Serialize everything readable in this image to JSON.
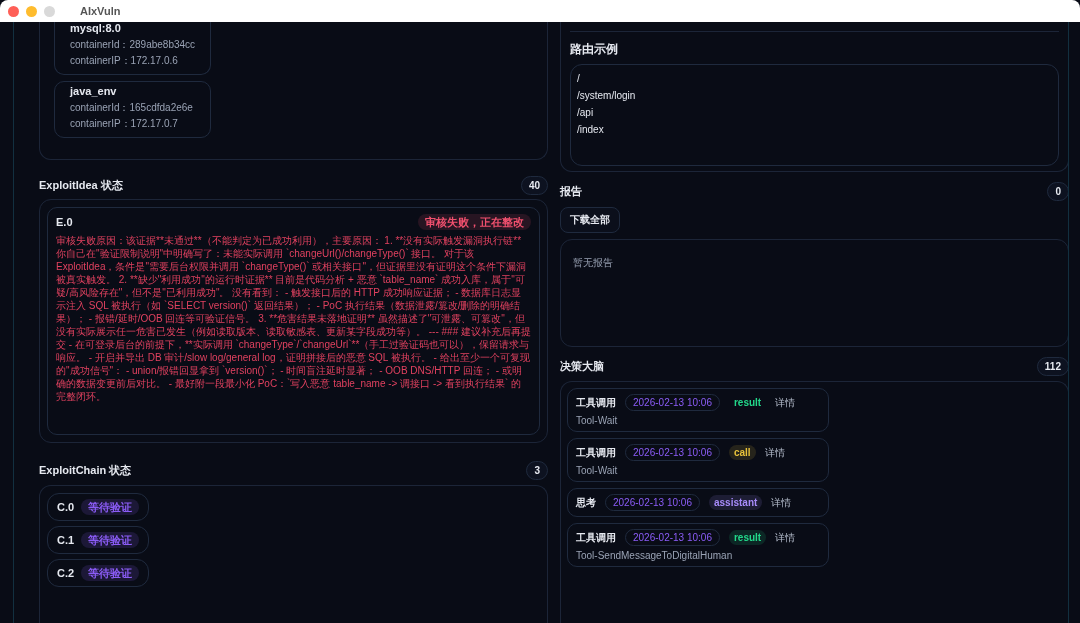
{
  "window": {
    "title": "AIxVuln"
  },
  "containers": [
    {
      "name": "mysql:8.0",
      "id_label": "containerId：",
      "id": "289abe8b34cc",
      "ip_label": "containerIP：",
      "ip": "172.17.0.6"
    },
    {
      "name": "java_env",
      "id_label": "containerId：",
      "id": "165cdfda2e6e",
      "ip_label": "containerIP：",
      "ip": "172.17.0.7"
    }
  ],
  "exploit_idea": {
    "title": "ExploitIdea 状态",
    "count": "40",
    "items": [
      {
        "name": "E.0",
        "status": "审核失败，正在整改",
        "color": "#f0506e",
        "text": "审核失败原因：该证据**未通过**（不能判定为已成功利用），主要原因： 1. **没有实际触发漏洞执行链** 你自己在\"验证限制说明\"中明确写了：未能实际调用 `changeUrl()/changeType()` 接口。 对于该 ExploitIdea，条件是\"需要后台权限并调用 `changeType()` 或相关接口\"，但证据里没有证明这个条件下漏洞被真实触发。 2. **缺少\"利用成功\"的运行时证据** 目前是代码分析 + 恶意 `table_name` 成功入库，属于\"可疑/高风险存在\"，但不是\"已利用成功\"。 没有看到： - 触发接口后的 HTTP 成功响应证据； - 数据库日志显示注入 SQL 被执行（如 `SELECT version()` 返回结果）； - PoC 执行结果（数据泄露/篡改/删除的明确结果）； - 报错/延时/OOB 回连等可验证信号。 3. **危害结果未落地证明** 虽然描述了\"可泄露、可篡改\"，但没有实际展示任一危害已发生（例如读取版本、读取敏感表、更新某字段成功等）。 --- ### 建议补充后再提交 - 在可登录后台的前提下，**实际调用 `changeType`/`changeUrl`**（手工过验证码也可以），保留请求与响应。 - 开启并导出 DB 审计/slow log/general log，证明拼接后的恶意 SQL 被执行。 - 给出至少一个可复现的\"成功信号\"： - union/报错回显拿到 `version()`； - 时间盲注延时显著； - OOB DNS/HTTP 回连； - 或明确的数据变更前后对比。 - 最好附一段最小化 PoC：`写入恶意 table_name -> 调接口 -> 看到执行结果` 的完整闭环。"
      }
    ]
  },
  "exploit_chain": {
    "title": "ExploitChain 状态",
    "count": "3",
    "items": [
      {
        "name": "C.0",
        "status": "等待验证",
        "color": "#8b5cf6"
      },
      {
        "name": "C.1",
        "status": "等待验证",
        "color": "#8b5cf6"
      },
      {
        "name": "C.2",
        "status": "等待验证",
        "color": "#8b5cf6"
      }
    ]
  },
  "routes": {
    "title": "路由示例",
    "items": [
      "/",
      "/system/login",
      "/api",
      "/index"
    ]
  },
  "reports": {
    "title": "报告",
    "count": "0",
    "download_button": "下载全部",
    "empty_text": "暂无报告"
  },
  "brain": {
    "title": "决策大脑",
    "count": "112",
    "entries": [
      {
        "type": "工具调用",
        "time": "2026-02-13 10:06",
        "tag": "result",
        "color": "#22d88a",
        "detail": "详情",
        "subtitle": "Tool-Wait"
      },
      {
        "type": "工具调用",
        "time": "2026-02-13 10:06",
        "tag": "call",
        "color": "#e8c23a",
        "detail": "详情",
        "subtitle": "Tool-Wait"
      },
      {
        "type": "思考",
        "time": "2026-02-13 10:06",
        "tag": "assistant",
        "color": "#a78bfa",
        "detail": "详情"
      },
      {
        "type": "工具调用",
        "time": "2026-02-13 10:06",
        "tag": "result",
        "color": "#22d88a",
        "detail": "详情",
        "subtitle": "Tool-SendMessageToDigitalHuman"
      }
    ]
  }
}
